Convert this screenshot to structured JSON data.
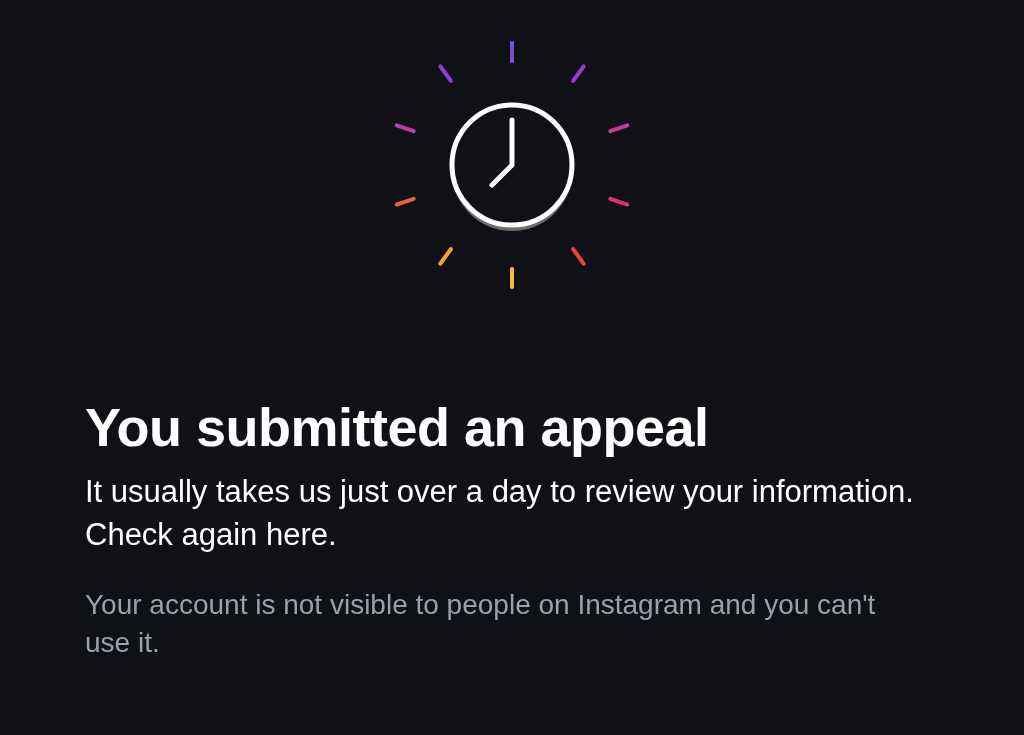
{
  "title": "You submitted an appeal",
  "message": "It usually takes us just over a day to review your information. Check again here.",
  "note": "Your account is not visible to people on Instagram and you can't use it."
}
